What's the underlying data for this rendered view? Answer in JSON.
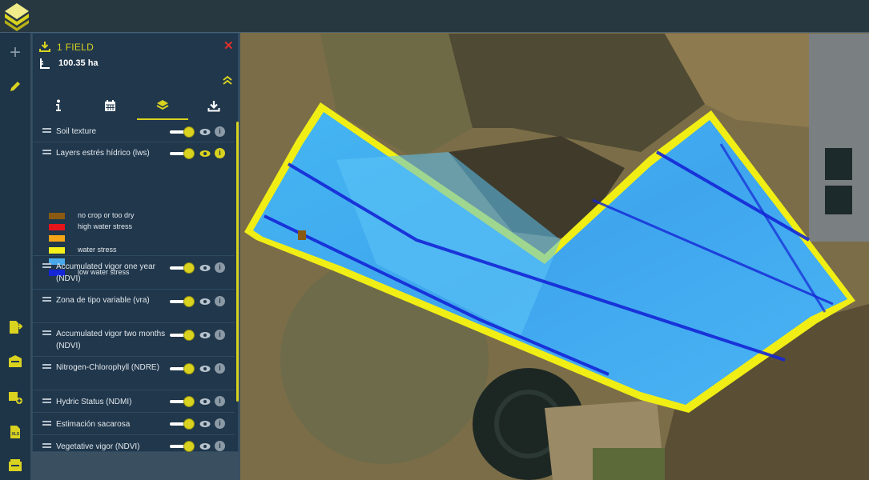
{
  "field": {
    "title": "1 FIELD",
    "area": "100.35 ha"
  },
  "tabs": [
    {
      "icon": "info-icon",
      "active": false
    },
    {
      "icon": "calendar-icon",
      "active": false
    },
    {
      "icon": "layers-icon",
      "active": true
    },
    {
      "icon": "download-icon",
      "active": false
    }
  ],
  "layers": [
    {
      "name": "Soil texture",
      "enabled": true
    },
    {
      "name": "Layers estrés hídrico (lws)",
      "enabled": true,
      "info_active": true
    },
    {
      "name": "Accumulated vigor one year (NDVI)",
      "enabled": true
    },
    {
      "name": "Zona de tipo variable (vra)",
      "enabled": true
    },
    {
      "name": "Accumulated vigor two months (NDVI)",
      "enabled": true
    },
    {
      "name": "Nitrogen-Chlorophyll (NDRE)",
      "enabled": true
    },
    {
      "name": "Hydric Status (NDMI)",
      "enabled": true
    },
    {
      "name": "Estimación sacarosa",
      "enabled": true
    },
    {
      "name": "Vegetative vigor (NDVI)",
      "enabled": true
    }
  ],
  "legend": [
    {
      "label": "no crop or too dry",
      "color": "#8b5a12"
    },
    {
      "label": "high water stress",
      "color": "#e8141b"
    },
    {
      "label": "",
      "color": "#f5a515"
    },
    {
      "label": "water stress",
      "color": "#f5f01a"
    },
    {
      "label": "",
      "color": "#4aa9ea"
    },
    {
      "label": "low water stress",
      "color": "#1426d6"
    }
  ],
  "colors": {
    "accent": "#d9d21f",
    "panel": "#20374c",
    "close": "#e0302a"
  }
}
